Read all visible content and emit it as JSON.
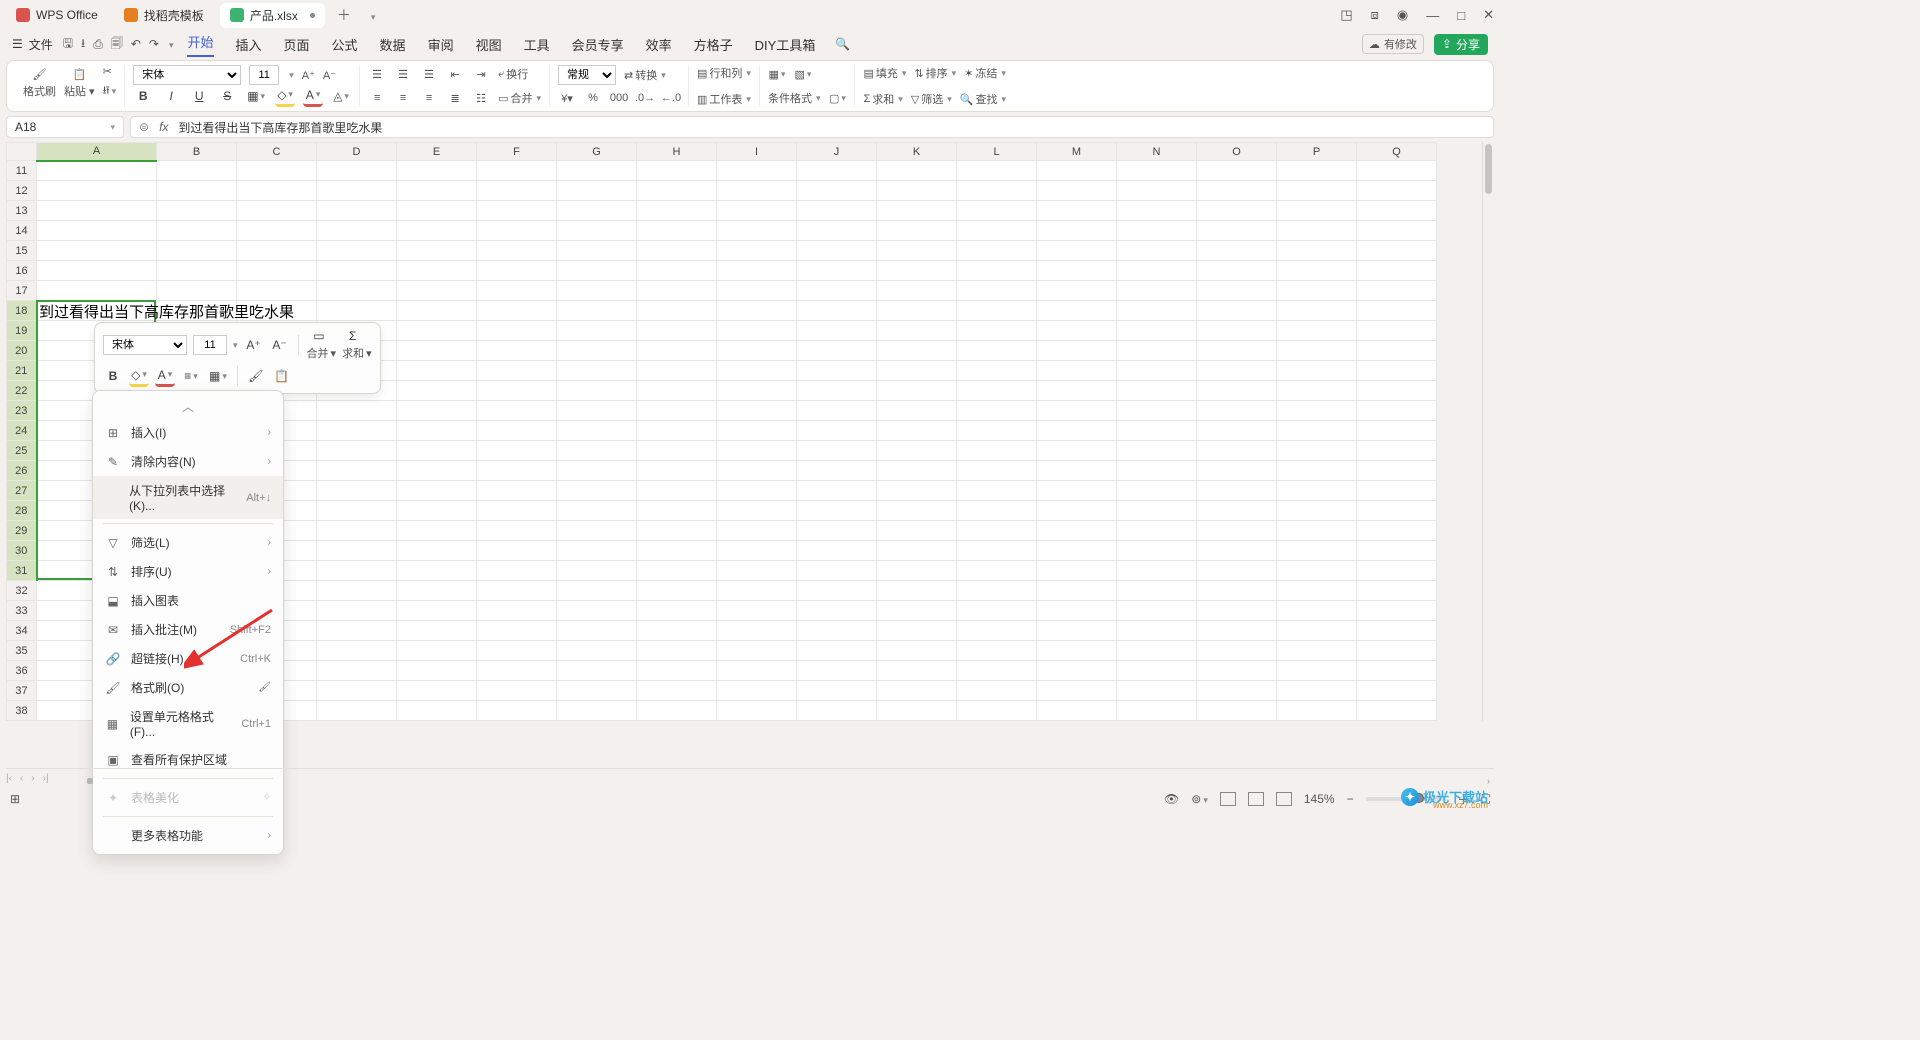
{
  "titlebar": {
    "tabs": [
      {
        "label": "WPS Office",
        "iconClass": "w",
        "active": false
      },
      {
        "label": "找稻壳模板",
        "iconClass": "d",
        "active": false
      },
      {
        "label": "产品.xlsx",
        "iconClass": "s",
        "active": true
      }
    ]
  },
  "menubar": {
    "file": "文件",
    "items": [
      "开始",
      "插入",
      "页面",
      "公式",
      "数据",
      "审阅",
      "视图",
      "工具",
      "会员专享",
      "效率",
      "方格子",
      "DIY工具箱"
    ],
    "activeIndex": 0,
    "modify": "有修改",
    "share": "分享"
  },
  "ribbon": {
    "formatBrush": "格式刷",
    "paste": "粘贴",
    "font": "宋体",
    "fontSize": "11",
    "bold": "B",
    "italic": "I",
    "underline": "U",
    "strike": "S",
    "wrap": "换行",
    "merge": "合并",
    "numberFormat": "常规",
    "convert": "转换",
    "rowCol": "行和列",
    "worksheet": "工作表",
    "condFormat": "条件格式",
    "fill": "填充",
    "sort": "排序",
    "freeze": "冻结",
    "sum": "求和",
    "filter": "筛选",
    "find": "查找"
  },
  "formula": {
    "cellRef": "A18",
    "content": "到过看得出当下高库存那首歌里吃水果"
  },
  "grid": {
    "columns": [
      "A",
      "B",
      "C",
      "D",
      "E",
      "F",
      "G",
      "H",
      "I",
      "J",
      "K",
      "L",
      "M",
      "N",
      "O",
      "P",
      "Q"
    ],
    "startRow": 11,
    "endRow": 38,
    "cellText": "到过看得出当下高库存那首歌里吃水果",
    "selectedRow": 18
  },
  "miniToolbar": {
    "font": "宋体",
    "fontSize": "11",
    "increaseFont": "A+",
    "decreaseFont": "A-",
    "bold": "B",
    "merge": "合并",
    "sum": "求和"
  },
  "contextMenu": {
    "insert": "插入(I)",
    "clear": "清除内容(N)",
    "dropdownSelect": "从下拉列表中选择(K)...",
    "dropdownShortcut": "Alt+↓",
    "filter": "筛选(L)",
    "sort": "排序(U)",
    "insertChart": "插入图表",
    "insertComment": "插入批注(M)",
    "commentShortcut": "Shift+F2",
    "hyperlink": "超链接(H)...",
    "hyperlinkShortcut": "Ctrl+K",
    "formatPainter": "格式刷(O)",
    "formatCells": "设置单元格格式(F)...",
    "formatCellsShortcut": "Ctrl+1",
    "protectArea": "查看所有保护区域",
    "tableBeautify": "表格美化",
    "moreFunctions": "更多表格功能"
  },
  "statusbar": {
    "zoom": "145%"
  },
  "watermark": {
    "text": "极光下载站",
    "url": "www.xz7.com"
  }
}
